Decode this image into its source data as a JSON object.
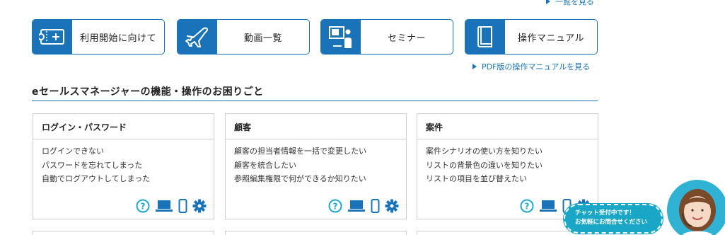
{
  "top_link": {
    "label": "一覧を見る"
  },
  "nav": [
    {
      "label": "利用開始に向けて",
      "icon": "ticket-icon"
    },
    {
      "label": "動画一覧",
      "icon": "airplane-icon"
    },
    {
      "label": "セミナー",
      "icon": "presentation-icon"
    },
    {
      "label": "操作マニュアル",
      "icon": "book-icon"
    }
  ],
  "pdf_link": {
    "label": "PDF版の操作マニュアルを見る"
  },
  "section": {
    "title": "eセールスマネージャーの機能・操作のお困りごと"
  },
  "cards": [
    {
      "title": "ログイン・パスワード",
      "items": [
        "ログインできない",
        "パスワードを忘れてしまった",
        "自動でログアウトしてしまった"
      ]
    },
    {
      "title": "顧客",
      "items": [
        "顧客の担当者情報を一括で変更したい",
        "顧客を統合したい",
        "参照編集権限で何ができるか知りたい"
      ]
    },
    {
      "title": "案件",
      "items": [
        "案件シナリオの使い方を知りたい",
        "リストの背景色の違いを知りたい",
        "リストの項目を並び替えたい"
      ]
    }
  ],
  "chat": {
    "line1": "チャット受付中です！",
    "line2": "お気軽にお問合せください"
  },
  "colors": {
    "accent": "#1a73b8",
    "icon_cyan": "#20a8cf",
    "chat": "#1aa6c7"
  }
}
